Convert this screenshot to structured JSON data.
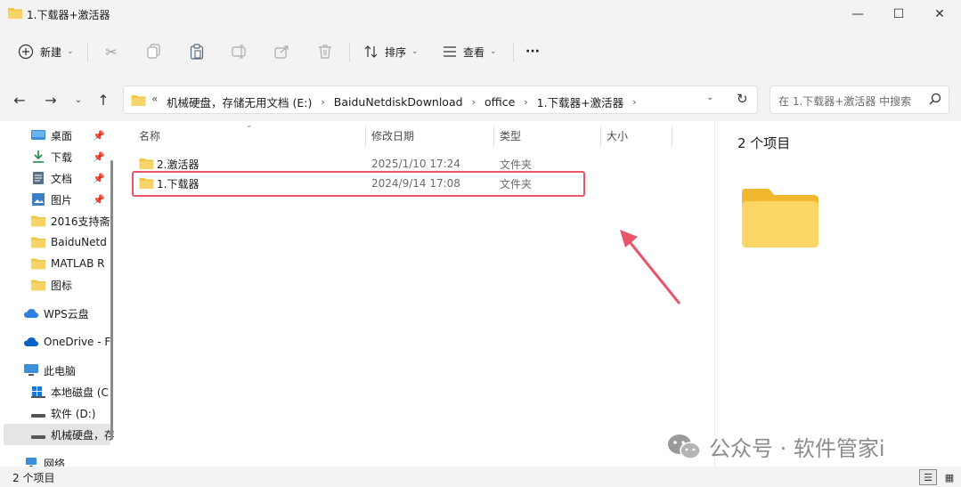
{
  "window": {
    "title": "1.下载器+激活器"
  },
  "window_controls": {
    "minimize": "—",
    "maximize": "☐",
    "close": "✕"
  },
  "toolbar": {
    "new_label": "新建",
    "sort_label": "排序",
    "view_label": "查看",
    "more_label": "···"
  },
  "address": {
    "overflow": "«",
    "crumbs": [
      "机械硬盘，存储无用文档 (E:)",
      "BaiduNetdiskDownload",
      "office",
      "1.下载器+激活器"
    ],
    "separator": "›"
  },
  "search": {
    "placeholder": "在 1.下载器+激活器 中搜索"
  },
  "nav": {
    "quick": [
      {
        "label": "桌面",
        "icon": "desktop-icon",
        "pinned": true
      },
      {
        "label": "下载",
        "icon": "download-icon",
        "pinned": true
      },
      {
        "label": "文档",
        "icon": "document-icon",
        "pinned": true
      },
      {
        "label": "图片",
        "icon": "picture-icon",
        "pinned": true
      },
      {
        "label": "2016支持斋",
        "icon": "folder-icon"
      },
      {
        "label": "BaiduNetd",
        "icon": "folder-icon"
      },
      {
        "label": "MATLAB R",
        "icon": "folder-icon"
      },
      {
        "label": "图标",
        "icon": "folder-icon"
      }
    ],
    "wps": "WPS云盘",
    "onedrive": "OneDrive - F",
    "thispc": "此电脑",
    "drives": [
      "本地磁盘 (C",
      "软件 (D:)",
      "机械硬盘，存"
    ],
    "network": "网络"
  },
  "columns": {
    "name": "名称",
    "date": "修改日期",
    "type": "类型",
    "size": "大小"
  },
  "files": [
    {
      "name": "2.激活器",
      "date": "2025/1/10 17:24",
      "type": "文件夹"
    },
    {
      "name": "1.下载器",
      "date": "2024/9/14 17:08",
      "type": "文件夹"
    }
  ],
  "preview": {
    "count": "2 个项目"
  },
  "status": {
    "count": "2 个项目"
  },
  "watermark": {
    "text": "公众号 · 软件管家i"
  },
  "colors": {
    "highlight": "#e9546b",
    "folder": "#f3c541",
    "accent": "#0067c0"
  }
}
